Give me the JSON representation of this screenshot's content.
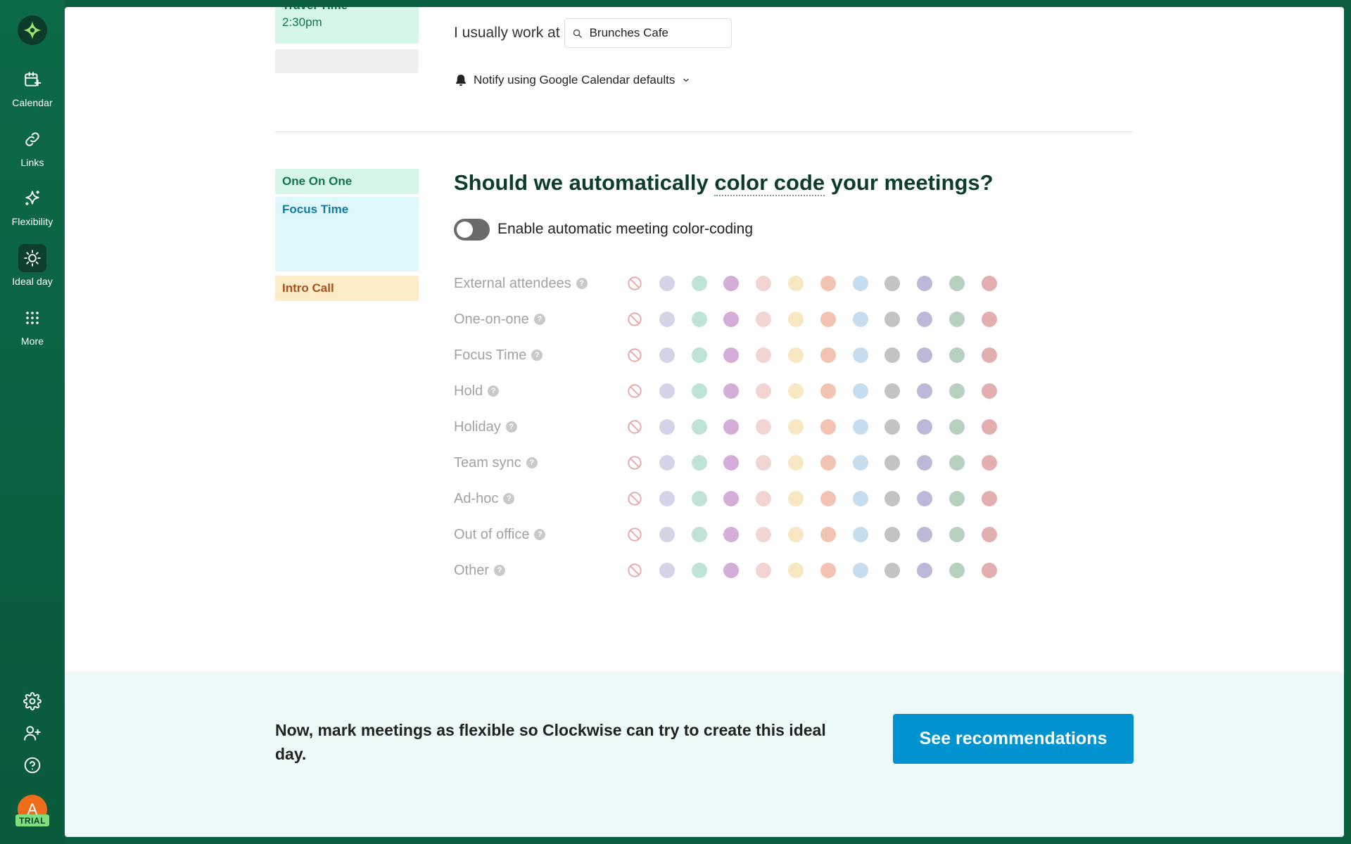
{
  "sidebar": {
    "items": [
      {
        "label": "Calendar",
        "icon": "calendar-plus-icon"
      },
      {
        "label": "Links",
        "icon": "link-icon"
      },
      {
        "label": "Flexibility",
        "icon": "sparkle-icon"
      },
      {
        "label": "Ideal day",
        "icon": "sun-icon"
      },
      {
        "label": "More",
        "icon": "grid-dots-icon"
      }
    ],
    "active_item": "Ideal day",
    "avatar_initial": "A",
    "trial_badge": "TRIAL"
  },
  "preview_blocks": {
    "travel_title": "Travel Time",
    "travel_time": "2:30pm",
    "one_on_one": "One On One",
    "focus_time": "Focus Time",
    "intro_call": "Intro Call"
  },
  "work_location": {
    "label": "I usually work at",
    "value": "Brunches Cafe"
  },
  "notify": {
    "label": "Notify using Google Calendar defaults"
  },
  "color_coding": {
    "heading_before": "Should we automatically ",
    "heading_link": "color code",
    "heading_after": " your meetings?",
    "toggle_label": "Enable automatic meeting color-coding",
    "toggle_on": false,
    "help_glyph": "?",
    "palette": [
      "#d4d4e8",
      "#bfe3d4",
      "#d4aed8",
      "#f2d4d2",
      "#f7e7c2",
      "#f2c3b2",
      "#c5ddef",
      "#c3c3c3",
      "#babad8",
      "#b8d0bf",
      "#e3aeb0"
    ],
    "rows": [
      {
        "label": "External attendees"
      },
      {
        "label": "One-on-one"
      },
      {
        "label": "Focus Time"
      },
      {
        "label": "Hold"
      },
      {
        "label": "Holiday"
      },
      {
        "label": "Team sync"
      },
      {
        "label": "Ad-hoc"
      },
      {
        "label": "Out of office"
      },
      {
        "label": "Other"
      }
    ]
  },
  "footer": {
    "text": "Now, mark meetings as flexible so Clockwise can try to create this ideal day.",
    "button_label": "See recommendations"
  }
}
